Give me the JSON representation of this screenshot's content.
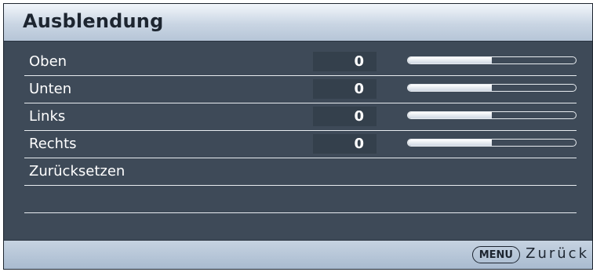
{
  "title": "Ausblendung",
  "rows": [
    {
      "label": "Oben",
      "value": "0",
      "level": 0.5
    },
    {
      "label": "Unten",
      "value": "0",
      "level": 0.5
    },
    {
      "label": "Links",
      "value": "0",
      "level": 0.5
    },
    {
      "label": "Rechts",
      "value": "0",
      "level": 0.5
    }
  ],
  "reset_label": "Zurücksetzen",
  "footer": {
    "menu_key": "MENU",
    "back_label": "Zurück"
  }
}
